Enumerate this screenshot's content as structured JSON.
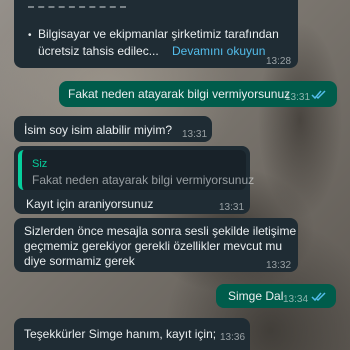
{
  "messages": {
    "m1": {
      "line1": "Bilgisayar ve ekipmanlar şirketimiz tarafından",
      "line2": "ücretsiz tahsis edilec...",
      "more_link": "Devamını okuyun",
      "time": "13:28"
    },
    "m2": {
      "text": "Fakat neden atayarak bilgi vermiyorsunuz",
      "time": "13:31",
      "status": "read"
    },
    "m3": {
      "text": "İsim soy isim alabilir miyim?",
      "time": "13:31"
    },
    "m4": {
      "quote_sender": "Siz",
      "quote_text": "Fakat neden atayarak bilgi vermiyorsunuz",
      "text": "Kayıt için araniyorsunuz",
      "time": "13:31"
    },
    "m5": {
      "line1": "Sizlerden önce mesajla sonra sesli şekilde iletişime",
      "line2": "geçmemiz gerekiyor gerekli özellikler mevcut mu",
      "line3": "diye sormamiz gerek",
      "time": "13:32"
    },
    "m6": {
      "text": "Simge Dal",
      "time": "13:34",
      "status": "read"
    },
    "m7": {
      "text": "Teşekkürler Simge hanım, kayıt için;",
      "time": "13:36"
    }
  },
  "colors": {
    "incoming_bubble": "#1f2c34",
    "outgoing_bubble": "#005c4b",
    "read_ticks": "#53bdeb",
    "quote_accent": "#06cf9c"
  }
}
